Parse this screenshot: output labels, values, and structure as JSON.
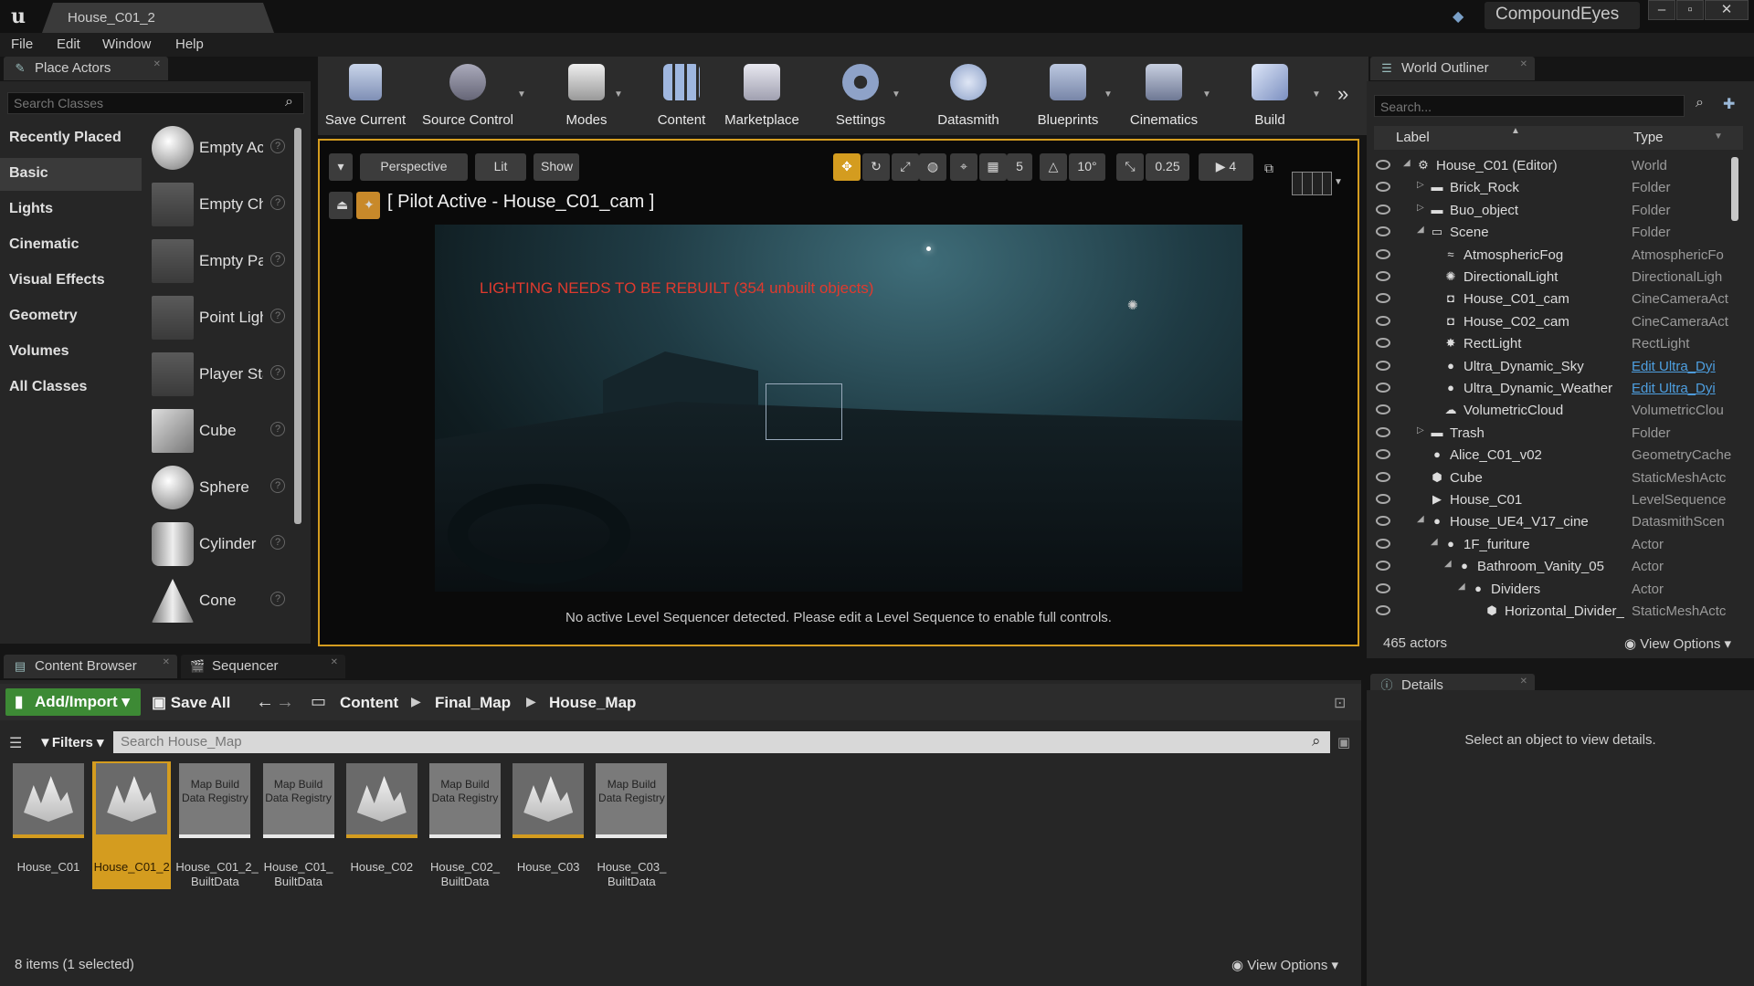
{
  "title_bar": {
    "logo": "u",
    "doc_tab": "House_C01_2",
    "project": "CompoundEyes"
  },
  "menu": [
    "File",
    "Edit",
    "Window",
    "Help"
  ],
  "place_actors": {
    "tab": "Place Actors",
    "search_placeholder": "Search Classes",
    "categories": [
      "Recently Placed",
      "Basic",
      "Lights",
      "Cinematic",
      "Visual Effects",
      "Geometry",
      "Volumes",
      "All Classes"
    ],
    "selected_category": "Basic",
    "actors": [
      "Empty Actor",
      "Empty Character",
      "Empty Pawn",
      "Point Light",
      "Player Start",
      "Cube",
      "Sphere",
      "Cylinder",
      "Cone"
    ]
  },
  "toolbar": [
    "Save Current",
    "Source Control",
    "Modes",
    "Content",
    "Marketplace",
    "Settings",
    "Datasmith",
    "Blueprints",
    "Cinematics",
    "Build"
  ],
  "viewport": {
    "perspective": "Perspective",
    "lit": "Lit",
    "show": "Show",
    "grid_snap": "5",
    "rot_snap": "10°",
    "scale_snap": "0.25",
    "cam_speed": "4",
    "pilot": "[ Pilot Active - House_C01_cam ]",
    "warning": "LIGHTING NEEDS TO BE REBUILT (354 unbuilt objects)",
    "message": "No active Level Sequencer detected. Please edit a Level Sequence to enable full controls."
  },
  "outliner": {
    "tab": "World Outliner",
    "search_placeholder": "Search...",
    "col_label": "Label",
    "col_type": "Type",
    "rows": [
      {
        "label": "House_C01 (Editor)",
        "type": "World",
        "indent": 0,
        "arrow": "◢",
        "icon": "world-icon"
      },
      {
        "label": "Brick_Rock",
        "type": "Folder",
        "indent": 1,
        "arrow": "▷",
        "icon": "folder-icon"
      },
      {
        "label": "Buo_object",
        "type": "Folder",
        "indent": 1,
        "arrow": "▷",
        "icon": "folder-icon"
      },
      {
        "label": "Scene",
        "type": "Folder",
        "indent": 1,
        "arrow": "◢",
        "icon": "folder-open-icon"
      },
      {
        "label": "AtmosphericFog",
        "type": "AtmosphericFo",
        "indent": 2,
        "arrow": "",
        "icon": "fog-icon"
      },
      {
        "label": "DirectionalLight",
        "type": "DirectionalLigh",
        "indent": 2,
        "arrow": "",
        "icon": "sun-icon"
      },
      {
        "label": "House_C01_cam",
        "type": "CineCameraAct",
        "indent": 2,
        "arrow": "",
        "icon": "camera-icon"
      },
      {
        "label": "House_C02_cam",
        "type": "CineCameraAct",
        "indent": 2,
        "arrow": "",
        "icon": "camera-icon"
      },
      {
        "label": "RectLight",
        "type": "RectLight",
        "indent": 2,
        "arrow": "",
        "icon": "light-icon"
      },
      {
        "label": "Ultra_Dynamic_Sky",
        "type": "Edit Ultra_Dyi",
        "indent": 2,
        "arrow": "",
        "icon": "sphere-icon",
        "link": true
      },
      {
        "label": "Ultra_Dynamic_Weather",
        "type": "Edit Ultra_Dyi",
        "indent": 2,
        "arrow": "",
        "icon": "sphere-icon",
        "link": true
      },
      {
        "label": "VolumetricCloud",
        "type": "VolumetricClou",
        "indent": 2,
        "arrow": "",
        "icon": "cloud-icon"
      },
      {
        "label": "Trash",
        "type": "Folder",
        "indent": 1,
        "arrow": "▷",
        "icon": "folder-icon"
      },
      {
        "label": "Alice_C01_v02",
        "type": "GeometryCache",
        "indent": 1,
        "arrow": "",
        "icon": "sphere-icon"
      },
      {
        "label": "Cube",
        "type": "StaticMeshActc",
        "indent": 1,
        "arrow": "",
        "icon": "mesh-icon"
      },
      {
        "label": "House_C01",
        "type": "LevelSequence",
        "indent": 1,
        "arrow": "",
        "icon": "sequence-icon"
      },
      {
        "label": "House_UE4_V17_cine",
        "type": "DatasmithScen",
        "indent": 1,
        "arrow": "◢",
        "icon": "sphere-icon"
      },
      {
        "label": "1F_furiture",
        "type": "Actor",
        "indent": 2,
        "arrow": "◢",
        "icon": "sphere-icon"
      },
      {
        "label": "Bathroom_Vanity_05",
        "type": "Actor",
        "indent": 3,
        "arrow": "◢",
        "icon": "sphere-icon"
      },
      {
        "label": "Dividers",
        "type": "Actor",
        "indent": 4,
        "arrow": "◢",
        "icon": "sphere-icon"
      },
      {
        "label": "Horizontal_Divider_",
        "type": "StaticMeshActc",
        "indent": 5,
        "arrow": "",
        "icon": "mesh-icon"
      }
    ],
    "count": "465 actors",
    "view_options": "View Options"
  },
  "details": {
    "tab": "Details",
    "empty": "Select an object to view details."
  },
  "content_browser": {
    "tab": "Content Browser",
    "tab2": "Sequencer",
    "add": "Add/Import",
    "save_all": "Save All",
    "path": [
      "Content",
      "Final_Map",
      "House_Map"
    ],
    "filters": "Filters",
    "search_placeholder": "Search House_Map",
    "assets": [
      {
        "name": "House_C01",
        "kind": "map",
        "thumb": ""
      },
      {
        "name": "House_C01_2",
        "kind": "map",
        "selected": true,
        "thumb": ""
      },
      {
        "name": "House_C01_2_ BuiltData",
        "kind": "reg",
        "thumb": "Map Build Data Registry"
      },
      {
        "name": "House_C01_ BuiltData",
        "kind": "reg",
        "thumb": "Map Build Data Registry"
      },
      {
        "name": "House_C02",
        "kind": "map",
        "thumb": ""
      },
      {
        "name": "House_C02_ BuiltData",
        "kind": "reg",
        "thumb": "Map Build Data Registry"
      },
      {
        "name": "House_C03",
        "kind": "map",
        "thumb": ""
      },
      {
        "name": "House_C03_ BuiltData",
        "kind": "reg",
        "thumb": "Map Build Data Registry"
      }
    ],
    "status": "8 items (1 selected)",
    "view_options": "View Options"
  }
}
